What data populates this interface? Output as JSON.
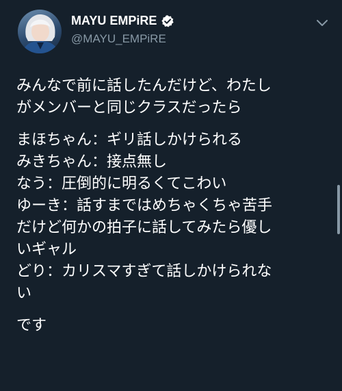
{
  "user": {
    "display_name": "MAYU EMPiRE",
    "handle": "@MAYU_EMPiRE",
    "verified_icon": "verified-badge-icon",
    "menu_icon": "chevron-down-icon"
  },
  "tweet": {
    "paragraphs": [
      [
        "みんなで前に話したんだけど、わたし",
        "がメンバーと同じクラスだったら"
      ],
      [
        "まほちゃん：ギリ話しかけられる",
        "みきちゃん：接点無し",
        "なう：圧倒的に明るくてこわい",
        "ゆーき：話すまではめちゃくちゃ苦手",
        "だけど何かの拍子に話してみたら優し",
        "いギャル",
        "どり：カリスマすぎて話しかけられな",
        "い"
      ],
      [
        "です"
      ]
    ]
  },
  "colors": {
    "background": "#15202b",
    "text": "#ffffff",
    "secondary_text": "#8899a6",
    "verified": "#ffffff"
  }
}
